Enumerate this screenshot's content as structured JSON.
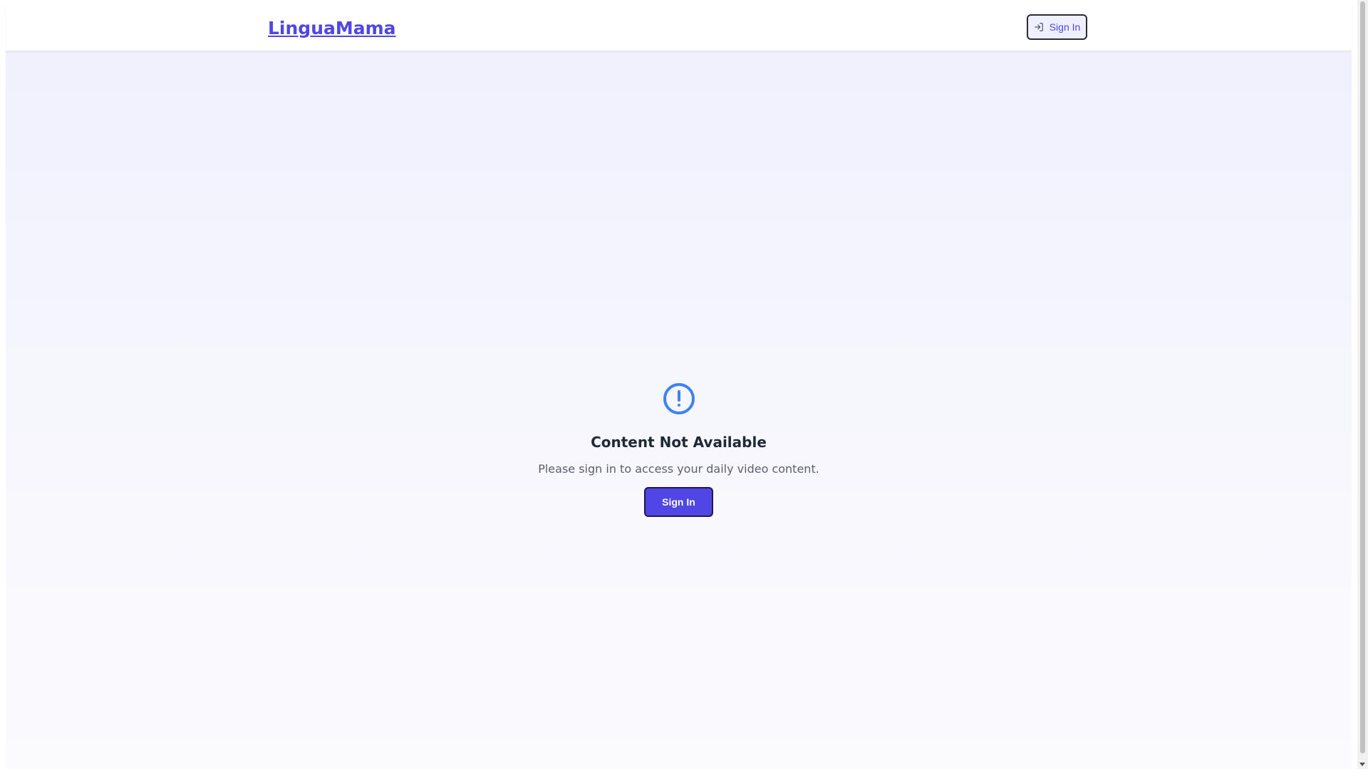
{
  "app": {
    "brand": "LinguaMama",
    "accent_color": "#4f46e5"
  },
  "header": {
    "sign_in_label": "Sign In",
    "sign_in_icon": "log-in-icon"
  },
  "main": {
    "icon": "alert-circle-icon",
    "title": "Content Not Available",
    "message": "Please sign in to access your daily video content.",
    "sign_in_label": "Sign In"
  }
}
